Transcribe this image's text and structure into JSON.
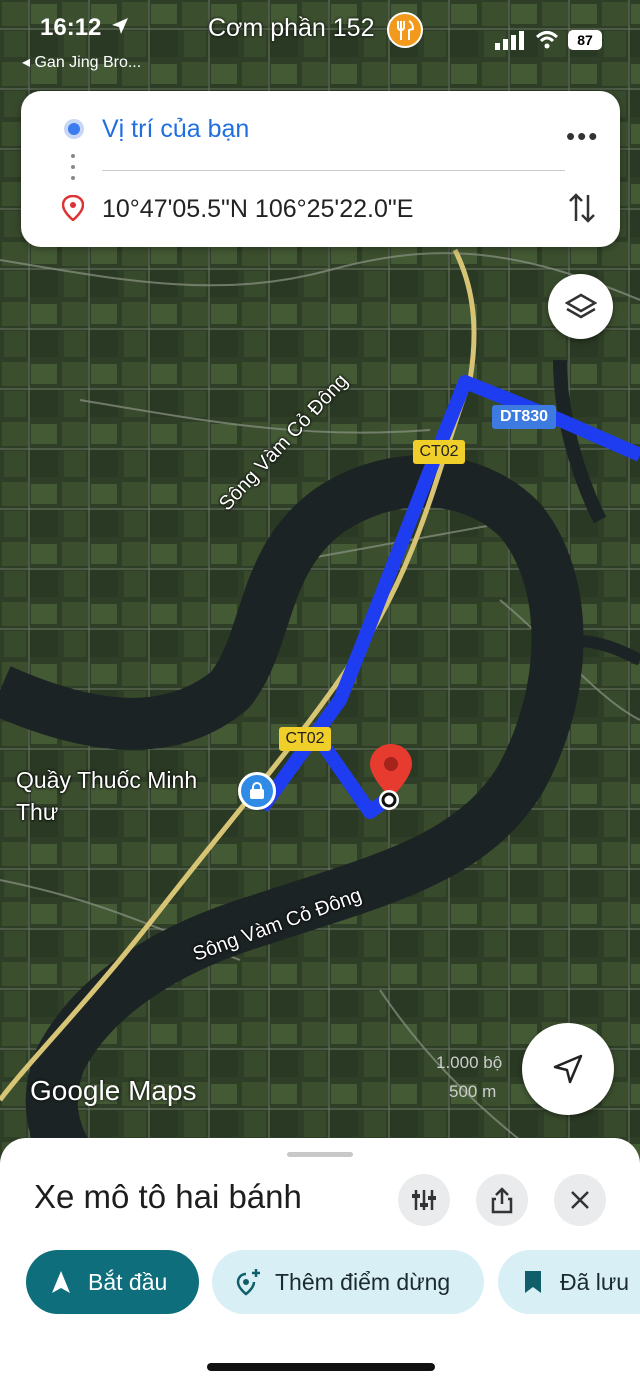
{
  "status_bar": {
    "time": "16:12",
    "back_label": "◂ Gan Jing Bro...",
    "battery": "87"
  },
  "map": {
    "top_place": "Cơm phần 152",
    "river_label_1": "Sông Vàm Cỏ Đông",
    "river_label_2": "Sông Vàm Cỏ Đông",
    "road_ct02_a": "CT02",
    "road_ct02_b": "CT02",
    "road_dt830": "DT830",
    "shop_label_line1": "Quầy Thuốc Minh",
    "shop_label_line2": "Thư",
    "brand": "Google Maps",
    "scale_imperial": "1.000 bộ",
    "scale_metric": "500 m",
    "route_color": "#1e3df0"
  },
  "directions": {
    "origin": "Vị trí của bạn",
    "destination": "10°47'05.5\"N 106°25'22.0\"E"
  },
  "sheet": {
    "travel_mode": "Xe mô tô hai bánh",
    "start_label": "Bắt đầu",
    "add_stop_label": "Thêm điểm dừng",
    "saved_label": "Đã lưu"
  }
}
